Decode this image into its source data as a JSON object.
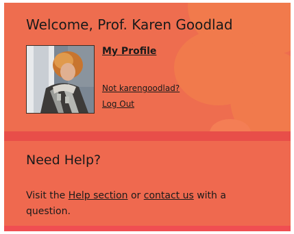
{
  "welcome": {
    "title": "Welcome, Prof. Karen Goodlad",
    "avatar_alt": "Profile photo of Karen Goodlad",
    "my_profile_label": "My Profile",
    "not_user_label": "Not karengoodlad?",
    "logout_label": "Log Out"
  },
  "help": {
    "title": "Need Help?",
    "text_before": "Visit the ",
    "help_section_label": "Help section",
    "text_middle": " or ",
    "contact_label": "contact us",
    "text_after": " with a question."
  },
  "colors": {
    "panel": "#ee6d4f",
    "band": "#e84e49",
    "text": "#1a1a1a"
  }
}
